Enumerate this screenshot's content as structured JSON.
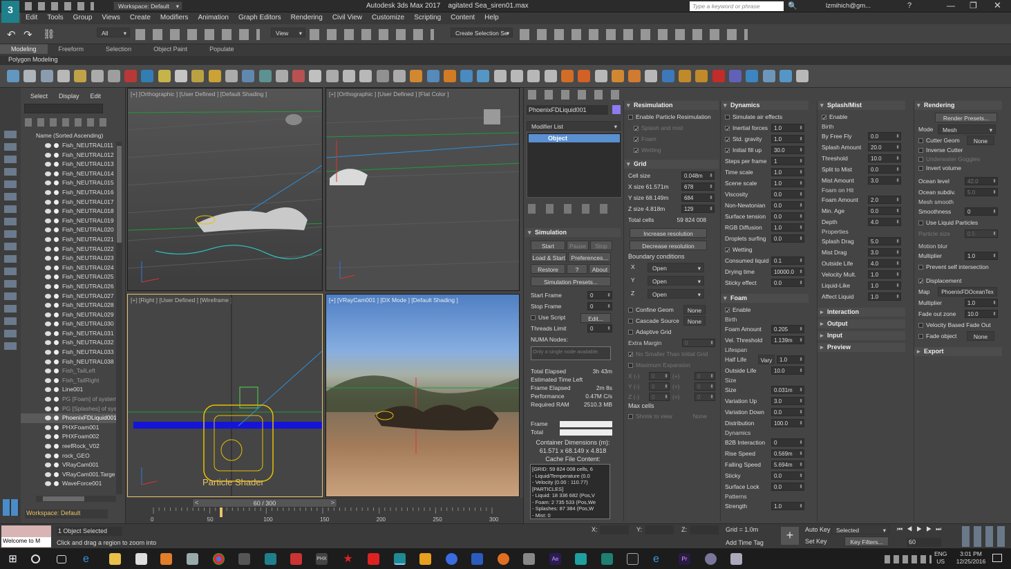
{
  "title": {
    "workspace": "Workspace: Default",
    "app": "Autodesk 3ds Max 2017",
    "file": "agitated Sea_siren01.max",
    "search_placeholder": "Type a keyword or phrase",
    "user": "lzmihich@gm..."
  },
  "menu": [
    "Edit",
    "Tools",
    "Group",
    "Views",
    "Create",
    "Modifiers",
    "Animation",
    "Graph Editors",
    "Rendering",
    "Civil View",
    "Customize",
    "Scripting",
    "Content",
    "Help"
  ],
  "toolbar": {
    "selection_filter": "All",
    "view": "View",
    "named_selection": "Create Selection Se"
  },
  "ribbon": {
    "tabs": [
      "Modeling",
      "Freeform",
      "Selection",
      "Object Paint",
      "Populate"
    ],
    "sub": "Polygon Modeling"
  },
  "scene": {
    "tabs": [
      "Select",
      "Display",
      "Edit"
    ],
    "sort": "Name (Sorted Ascending)",
    "items": [
      {
        "n": "Fish_NEUTRAL011",
        "s": ""
      },
      {
        "n": "Fish_NEUTRAL012",
        "s": ""
      },
      {
        "n": "Fish_NEUTRAL013",
        "s": ""
      },
      {
        "n": "Fish_NEUTRAL014",
        "s": ""
      },
      {
        "n": "Fish_NEUTRAL015",
        "s": ""
      },
      {
        "n": "Fish_NEUTRAL016",
        "s": ""
      },
      {
        "n": "Fish_NEUTRAL017",
        "s": ""
      },
      {
        "n": "Fish_NEUTRAL018",
        "s": ""
      },
      {
        "n": "Fish_NEUTRAL019",
        "s": ""
      },
      {
        "n": "Fish_NEUTRAL020",
        "s": ""
      },
      {
        "n": "Fish_NEUTRAL021",
        "s": ""
      },
      {
        "n": "Fish_NEUTRAL022",
        "s": ""
      },
      {
        "n": "Fish_NEUTRAL023",
        "s": ""
      },
      {
        "n": "Fish_NEUTRAL024",
        "s": ""
      },
      {
        "n": "Fish_NEUTRAL025",
        "s": ""
      },
      {
        "n": "Fish_NEUTRAL026",
        "s": ""
      },
      {
        "n": "Fish_NEUTRAL027",
        "s": ""
      },
      {
        "n": "Fish_NEUTRAL028",
        "s": ""
      },
      {
        "n": "Fish_NEUTRAL029",
        "s": ""
      },
      {
        "n": "Fish_NEUTRAL030",
        "s": ""
      },
      {
        "n": "Fish_NEUTRAL031",
        "s": ""
      },
      {
        "n": "Fish_NEUTRAL032",
        "s": ""
      },
      {
        "n": "Fish_NEUTRAL033",
        "s": ""
      },
      {
        "n": "Fish_NEUTRAL038",
        "s": ""
      },
      {
        "n": "Fish_TailLeft",
        "s": "dim"
      },
      {
        "n": "Fish_TailRight",
        "s": "dim"
      },
      {
        "n": "Line001",
        "s": ""
      },
      {
        "n": "PG [Foam] of system",
        "s": "dim"
      },
      {
        "n": "PG [Splashes] of sys",
        "s": "dim"
      },
      {
        "n": "PhoenixFDLiquid001",
        "s": "sel"
      },
      {
        "n": "PHXFoam001",
        "s": ""
      },
      {
        "n": "PHXFoam002",
        "s": ""
      },
      {
        "n": "reefRock_V02",
        "s": ""
      },
      {
        "n": "rock_GEO",
        "s": ""
      },
      {
        "n": "VRayCam001",
        "s": ""
      },
      {
        "n": "VRayCam001.Targe",
        "s": ""
      },
      {
        "n": "WaveForce001",
        "s": ""
      }
    ],
    "workspace": "Workspace: Default"
  },
  "viewports": {
    "tl": "[+] [Orthographic ] [User Defined ] [Default Shading ]",
    "tr": "[+] [Orthographic ] [User Defined ] [Flat Color ]",
    "bl": "[+] [Right ] [User Defined ] [Wireframe ]",
    "br": "[+] [VRayCam001 ] [DX Mode ] [Default Shading ]",
    "particle_shader": "Particle Shader"
  },
  "modifier": {
    "object_name": "PhoenixFDLiquid001",
    "list": "Modifier List",
    "stack_item": "Object"
  },
  "simulation": {
    "title": "Simulation",
    "start": "Start",
    "pause": "Pause",
    "stop": "Stop",
    "load_start": "Load & Start",
    "preferences": "Preferences...",
    "restore": "Restore",
    "q": "?",
    "about": "About",
    "presets": "Simulation Presets...",
    "start_frame_label": "Start Frame",
    "start_frame": "0",
    "stop_frame_label": "Stop Frame",
    "stop_frame": "0",
    "use_script": "Use Script",
    "edit": "Edit...",
    "threads_label": "Threads Limit",
    "threads": "0",
    "numa_label": "NUMA Nodes:",
    "numa_placeholder": "Only a single node available.",
    "stats": [
      [
        "Total Elapsed",
        "3h 43m"
      ],
      [
        "Estimated Time Left",
        ""
      ],
      [
        "Frame Elapsed",
        "2m 8s"
      ],
      [
        "Performance",
        "0.47M C/s"
      ],
      [
        "Required RAM",
        "2510.3 MB"
      ]
    ],
    "frame_label": "Frame",
    "total_label": "Total",
    "container": "Container Dimensions (m):",
    "container_val": "61.571 x 68.149 x 4.818",
    "cache_title": "Cache File Content:",
    "cache": [
      "[GRID: 59 824 008 cells, 6",
      "- Liquid/Temperature (0.0",
      "- Velocity (0.00 : 110.77)",
      "[PARTICLES]",
      "- Liquid: 18 336 682 (Pos,V",
      "- Foam: 2 735 533 (Pos,We",
      "- Splashes: 87 384 (Pos,W",
      "- Mist: 0",
      "- WetMap: 11 979 (Pos,Si"
    ]
  },
  "resim": {
    "title": "Resimulation",
    "enable": "Enable Particle Resimulation",
    "rows": [
      "Splash and mist",
      "Foam",
      "Wetting"
    ]
  },
  "grid": {
    "title": "Grid",
    "rows": [
      [
        "Cell size",
        "0.048m"
      ],
      [
        "X size 61.571m",
        "678"
      ],
      [
        "Y size 68.149m",
        "684"
      ],
      [
        "Z size 4.818m",
        "129"
      ]
    ],
    "total_label": "Total cells",
    "total": "59 824 008",
    "inc": "Increase resolution",
    "dec": "Decrease resolution",
    "boundary": "Boundary conditions",
    "bc": [
      [
        "X",
        "Open"
      ],
      [
        "Y",
        "Open"
      ],
      [
        "Z",
        "Open"
      ]
    ],
    "confine": "Confine Geom",
    "cascade": "Cascade Source",
    "none": "None",
    "adaptive": "Adaptive Grid",
    "extra_margin": "Extra Margin",
    "extra_val": "0",
    "no_smaller": "No Smaller Than Initial Grid",
    "max_exp": "Maximum Expansion",
    "xyz": [
      [
        "X (-)",
        "0",
        "(+)",
        "0"
      ],
      [
        "Y (-)",
        "0",
        "(+)",
        "0"
      ],
      [
        "Z (-)",
        "0",
        "(+)",
        "0"
      ]
    ],
    "max_cells": "Max cells",
    "shrink": "Shrink to view",
    "shrink_val": "None"
  },
  "dynamics": {
    "title": "Dynamics",
    "air": "Simulate air effects",
    "rows": [
      [
        "Inertial forces",
        "1.0",
        1
      ],
      [
        "Std. gravity",
        "1.0",
        1
      ],
      [
        "Initial fill up",
        "30.0",
        1
      ],
      [
        "Steps per frame",
        "1",
        0
      ],
      [
        "Time scale",
        "1.0",
        0
      ],
      [
        "Scene scale",
        "1.0",
        0
      ],
      [
        "Viscosity",
        "0.0",
        0
      ],
      [
        "Non-Newtonian",
        "0.0",
        0
      ],
      [
        "Surface tension",
        "0.0",
        0
      ],
      [
        "RGB Diffusion",
        "1.0",
        0
      ],
      [
        "Droplets surfing",
        "0.0",
        0
      ]
    ],
    "wetting": "Wetting",
    "wet_rows": [
      [
        "Consumed liquid",
        "0.1"
      ],
      [
        "Drying time",
        "10000.0"
      ],
      [
        "Sticky effect",
        "0.0"
      ]
    ]
  },
  "foam": {
    "title": "Foam",
    "enable": "Enable",
    "birth": "Birth",
    "birth_rows": [
      [
        "Foam Amount",
        "0.205"
      ],
      [
        "Vel. Threshold",
        "1.139m"
      ]
    ],
    "lifespan": "Lifespan",
    "half_life": "Half Life",
    "vary": "Vary",
    "half_val": "1.0",
    "outside_life": "Outside Life",
    "outside_val": "10.0",
    "size": "Size",
    "size_rows": [
      [
        "Size",
        "0.031m"
      ],
      [
        "Variation Up",
        "3.0"
      ],
      [
        "Variation Down",
        "0.0"
      ],
      [
        "Distribution",
        "100.0"
      ]
    ],
    "dyn": "Dynamics",
    "dyn_rows": [
      [
        "B2B Interaction",
        "0"
      ],
      [
        "Rise Speed",
        "0.569m"
      ],
      [
        "Falling Speed",
        "5.694m"
      ],
      [
        "Sticky",
        "0.0"
      ],
      [
        "Surface Lock",
        "0.0"
      ]
    ],
    "patterns": "Patterns",
    "strength": "Strength",
    "strength_val": "1.0"
  },
  "splash": {
    "title": "Splash/Mist",
    "enable": "Enable",
    "birth": "Birth",
    "rows": [
      [
        "By Free Fly",
        "0.0"
      ],
      [
        "Splash Amount",
        "20.0"
      ],
      [
        "Threshold",
        "10.0"
      ],
      [
        "Split to Mist",
        "0.0"
      ],
      [
        "Mist Amount",
        "3.0"
      ]
    ],
    "foam_hit": "Foam on Hit",
    "fh_rows": [
      [
        "Foam Amount",
        "2.0"
      ],
      [
        "Min. Age",
        "0.0"
      ],
      [
        "Depth",
        "4.0"
      ]
    ],
    "props": "Properties",
    "prop_rows": [
      [
        "Splash Drag",
        "5.0"
      ],
      [
        "Mist Drag",
        "3.0"
      ],
      [
        "Outside Life",
        "4.0"
      ],
      [
        "Velocity Mult.",
        "1.0"
      ],
      [
        "Liquid-Like",
        "1.0"
      ],
      [
        "Affect Liquid",
        "1.0"
      ]
    ],
    "collapsed": [
      "Interaction",
      "Output",
      "Input",
      "Preview"
    ]
  },
  "rendering": {
    "title": "Rendering",
    "presets": "Render Presets...",
    "mode_label": "Mode",
    "mode": "Mesh",
    "cutter": "Cutter Geom",
    "cutter_val": "None",
    "inverse_cutter": "Inverse Cutter",
    "underwater": "Underwater Goggles",
    "invert_vol": "Invert volume",
    "ocean_level": "Ocean level",
    "ocean_level_val": "42.0",
    "ocean_subdiv": "Ocean subdiv.",
    "ocean_subdiv_val": "5.0",
    "mesh_smooth": "Mesh smooth",
    "smoothness": "Smoothness",
    "smoothness_val": "0",
    "liquid_particles": "Use Liquid Particles",
    "particle_size": "Particle size",
    "particle_size_val": "0.5",
    "motion_blur": "Motion blur",
    "multiplier": "Multiplier",
    "multiplier_val": "1.0",
    "prevent": "Prevent self intersection",
    "displacement": "Displacement",
    "map_label": "Map",
    "map_val": "PhoenixFDOceanTex",
    "disp_mult": "Multiplier",
    "disp_mult_val": "1.0",
    "fade_zone": "Fade out zone",
    "fade_zone_val": "10.0",
    "vel_fade": "Velocity Based Fade Out",
    "fade_obj": "Fade object",
    "fade_obj_val": "None",
    "export": "Export"
  },
  "timeline": {
    "frame": "60 / 300",
    "ticks": [
      "0",
      "50",
      "100",
      "150",
      "200",
      "250",
      "300"
    ]
  },
  "status": {
    "maxscript": "Welcome to M",
    "selected": "1 Object Selected",
    "prompt": "Click and drag a region to zoom into",
    "x": "X:",
    "y": "Y:",
    "z": "Z:",
    "grid": "Grid = 1.0m",
    "add_time_tag": "Add Time Tag",
    "auto_key": "Auto Key",
    "set_key": "Set Key",
    "selected_dd": "Selected",
    "key_filters": "Key Filters...",
    "frame_field": "60"
  },
  "taskbar": {
    "lang": "ENG",
    "region": "US",
    "time": "3:01 PM",
    "date": "12/25/2016"
  }
}
